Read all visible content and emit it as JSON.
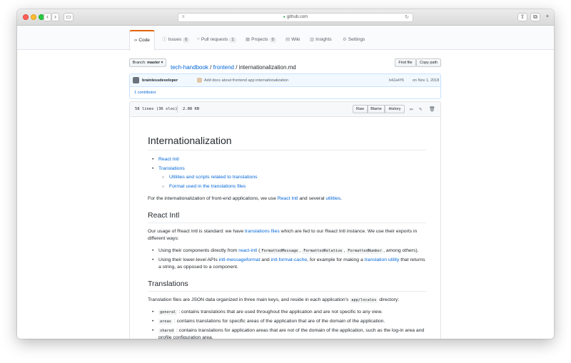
{
  "browser": {
    "url": "github.com",
    "back_icon": "chevron-left-icon",
    "forward_icon": "chevron-right-icon"
  },
  "repo_nav": {
    "tabs": [
      {
        "label": "Code",
        "icon": "code-icon",
        "selected": true
      },
      {
        "label": "Issues",
        "count": "0",
        "icon": "issue-icon"
      },
      {
        "label": "Pull requests",
        "count": "1",
        "icon": "pull-request-icon"
      },
      {
        "label": "Projects",
        "count": "0",
        "icon": "project-icon"
      },
      {
        "label": "Wiki",
        "icon": "book-icon"
      },
      {
        "label": "Insights",
        "icon": "graph-icon"
      },
      {
        "label": "Settings",
        "icon": "gear-icon"
      }
    ]
  },
  "file_nav": {
    "branch_label": "Branch:",
    "branch": "master",
    "breadcrumb": {
      "repo": "tech-handbook",
      "sep": "/",
      "dir": "frontend",
      "file": "internationalization.md"
    },
    "find_file": "Find file",
    "copy_path": "Copy path"
  },
  "commit": {
    "author": "brainlessdeveloper",
    "message": "Add docs about frontend app internationalization",
    "sha": "b42a4f6",
    "date": "on Nov 1, 2018",
    "contributors": "1 contributor"
  },
  "file_info": {
    "lines": "58 lines (36 sloc)",
    "size": "2.88 KB",
    "raw": "Raw",
    "blame": "Blame",
    "history": "History"
  },
  "doc": {
    "title": "Internationalization",
    "toc": {
      "react_intl": "React Intl",
      "translations": "Translations",
      "utilities": "Utilities and scripts related to translations",
      "format": "Format used in the translations files"
    },
    "intro": {
      "text1": "For the internationalization of front-end applications, we use ",
      "link1": "React Intl",
      "text2": " and several ",
      "link2": "utilities",
      "text3": "."
    },
    "h2_react_intl": "React Intl",
    "p_usage": {
      "text1": "Our usage of React Intl is standard: we have ",
      "link1": "translations files",
      "text2": " which are fed to our React Intl instance. We use their exports in different ways:"
    },
    "usage_list": {
      "item1": {
        "text1": "Using their components directly from ",
        "link1": "react-intl",
        "text2": " (",
        "code1": "FormattedMessage",
        "text3": ", ",
        "code2": "FormattedRelative",
        "text4": ", ",
        "code3": "FormattedNumber",
        "text5": ", among others)."
      },
      "item2": {
        "text1": "Using their lower-level APIs ",
        "link1": "intl-messageformat",
        "text2": " and ",
        "link2": "intl-format-cache",
        "text3": ", for example for making a ",
        "link3": "translation utility",
        "text4": " that returns a string, as opposed to a component."
      }
    },
    "h2_translations": "Translations",
    "p_translations": {
      "text1": "Translation files are JSON data organized in three main keys, and reside in each application's ",
      "code": "app/locales",
      "text2": " directory:"
    },
    "keys_list": [
      {
        "code": "general",
        "text": " : contains translations that are used throughout the application and are not specific to any view."
      },
      {
        "code": "areas",
        "text": " : contains translations for specific areas of the application that are of the domain of the application."
      },
      {
        "code": "shared",
        "text": " : contains translations for application areas that are not of the domain of the application, such as the log-in area and profile configuration area."
      }
    ]
  }
}
